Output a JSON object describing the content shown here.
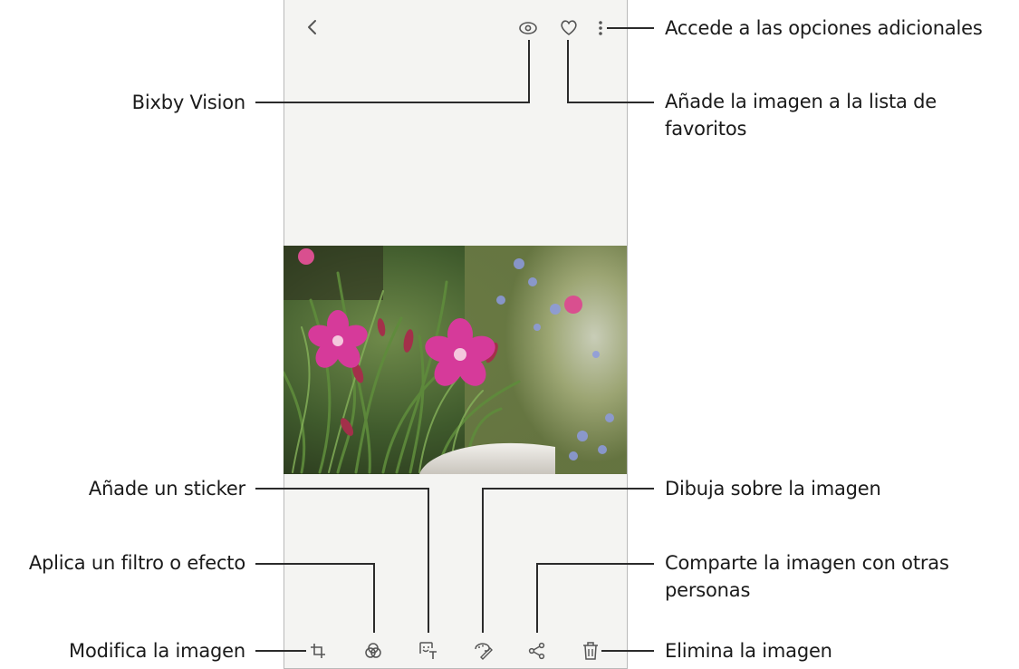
{
  "labels": {
    "more_options": "Accede a las opciones adicionales",
    "bixby_vision": "Bixby Vision",
    "favorite_line1": "Añade la imagen a la lista de",
    "favorite_line2": "favoritos",
    "sticker": "Añade un sticker",
    "draw": "Dibuja sobre la imagen",
    "filter": "Aplica un filtro o efecto",
    "share_line1": "Comparte la imagen con otras",
    "share_line2": "personas",
    "edit": "Modifica la imagen",
    "delete": "Elimina la imagen"
  },
  "icons": {
    "top_bar": [
      "back-icon",
      "bixby-vision-icon",
      "favorite-heart-icon",
      "more-options-icon"
    ],
    "bottom_bar": [
      "crop-edit-icon",
      "filter-icon",
      "sticker-icon",
      "draw-icon",
      "share-icon",
      "delete-icon"
    ]
  },
  "colors": {
    "leader_line": "#2b2b2b",
    "screen_bg": "#f4f4f2",
    "icon": "#555555",
    "flower": "#d63a9a"
  }
}
